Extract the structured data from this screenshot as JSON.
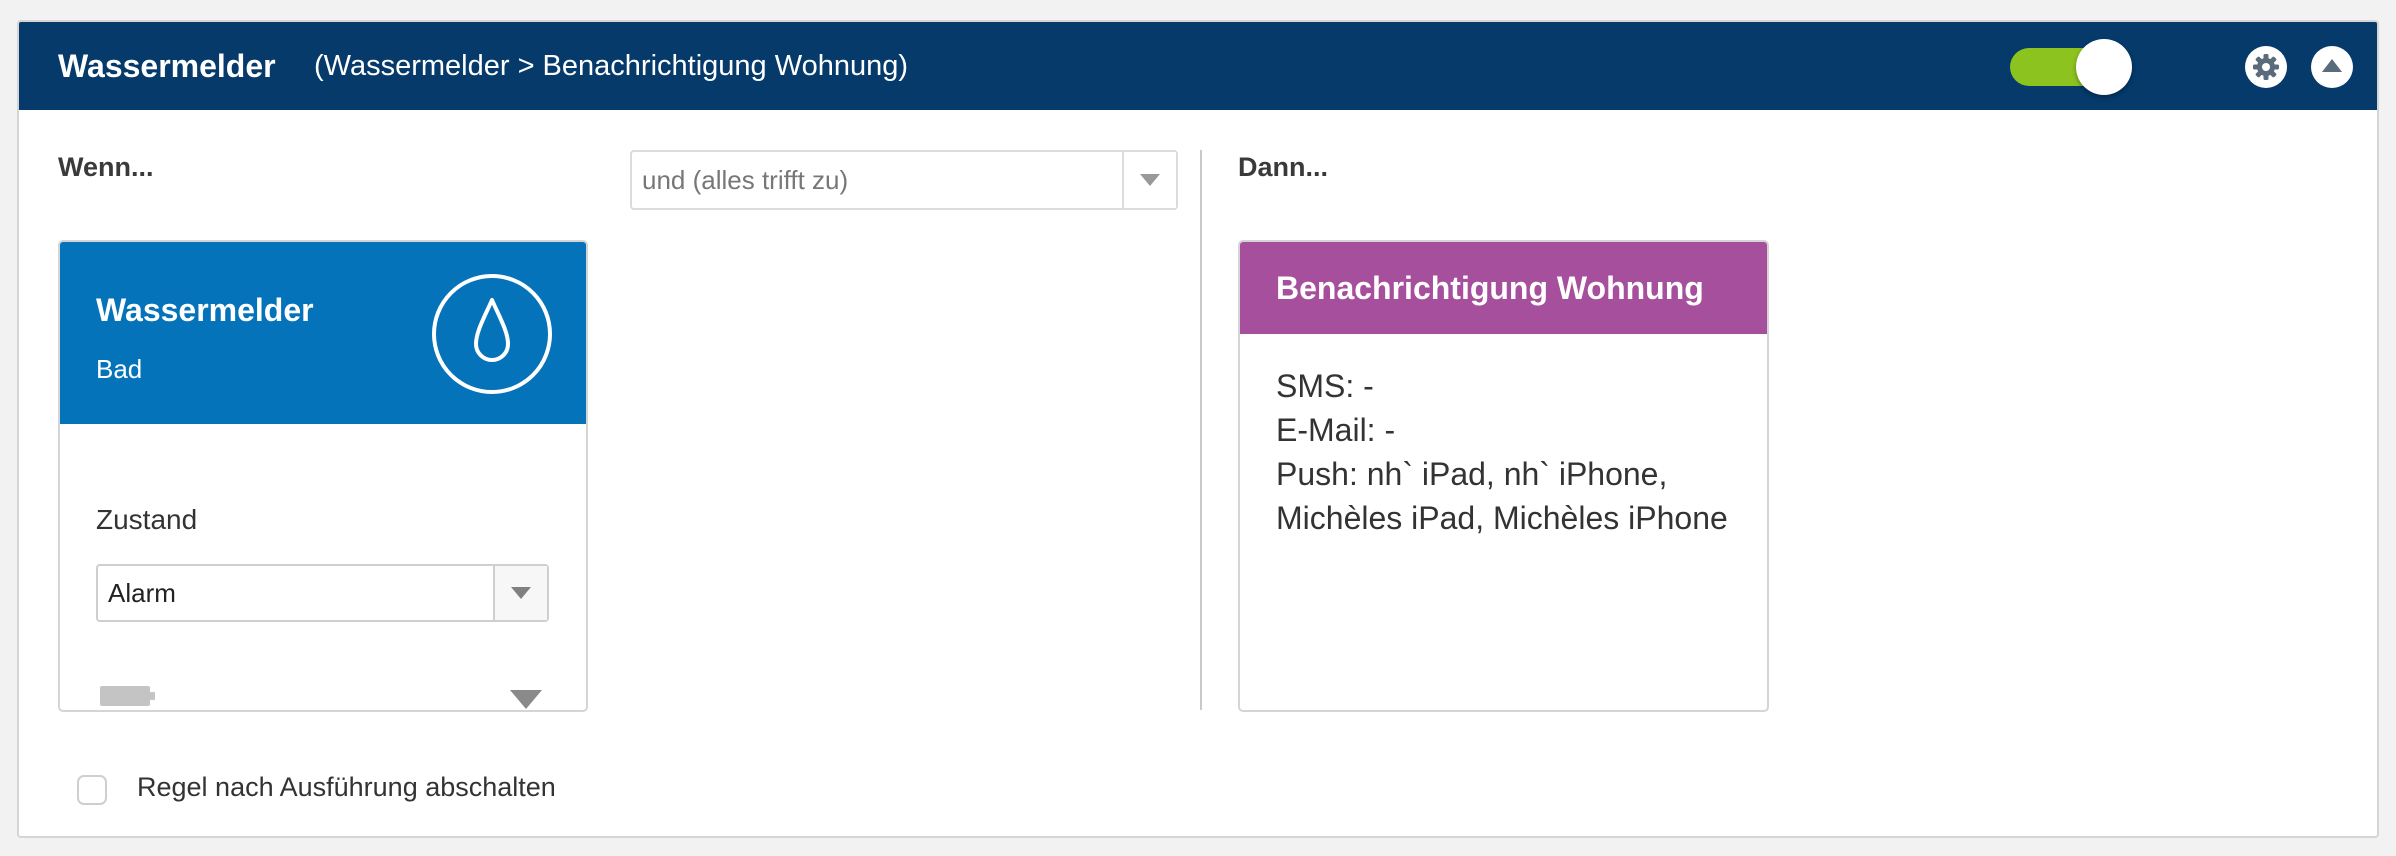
{
  "header": {
    "title": "Wassermelder",
    "subtitle": "(Wassermelder > Benachrichtigung Wohnung)",
    "toggle_on": true,
    "settings_icon": "gear-icon",
    "collapse_icon": "chevron-up-icon"
  },
  "conditions": {
    "label": "Wenn...",
    "combine_select": {
      "value": "und (alles trifft zu)"
    },
    "trigger_card": {
      "title": "Wassermelder",
      "subtitle": "Bad",
      "icon": "water-drop-icon",
      "field_label": "Zustand",
      "state_select": {
        "value": "Alarm"
      },
      "battery_icon": "battery-icon",
      "expand_icon": "chevron-down-icon"
    }
  },
  "actions": {
    "label": "Dann...",
    "action_card": {
      "title": "Benachrichtigung Wohnung",
      "lines": [
        "SMS: -",
        "E-Mail: -",
        "Push: nh` iPad, nh` iPhone, Michèles iPad, Michèles iPhone"
      ]
    }
  },
  "footer": {
    "checkbox_label": "Regel nach Ausführung abschalten",
    "checkbox_checked": false
  },
  "colors": {
    "header_bg": "#053a6b",
    "trigger_bg": "#0573b9",
    "action_bg": "#a64f9d",
    "toggle_on": "#8dc31e"
  }
}
